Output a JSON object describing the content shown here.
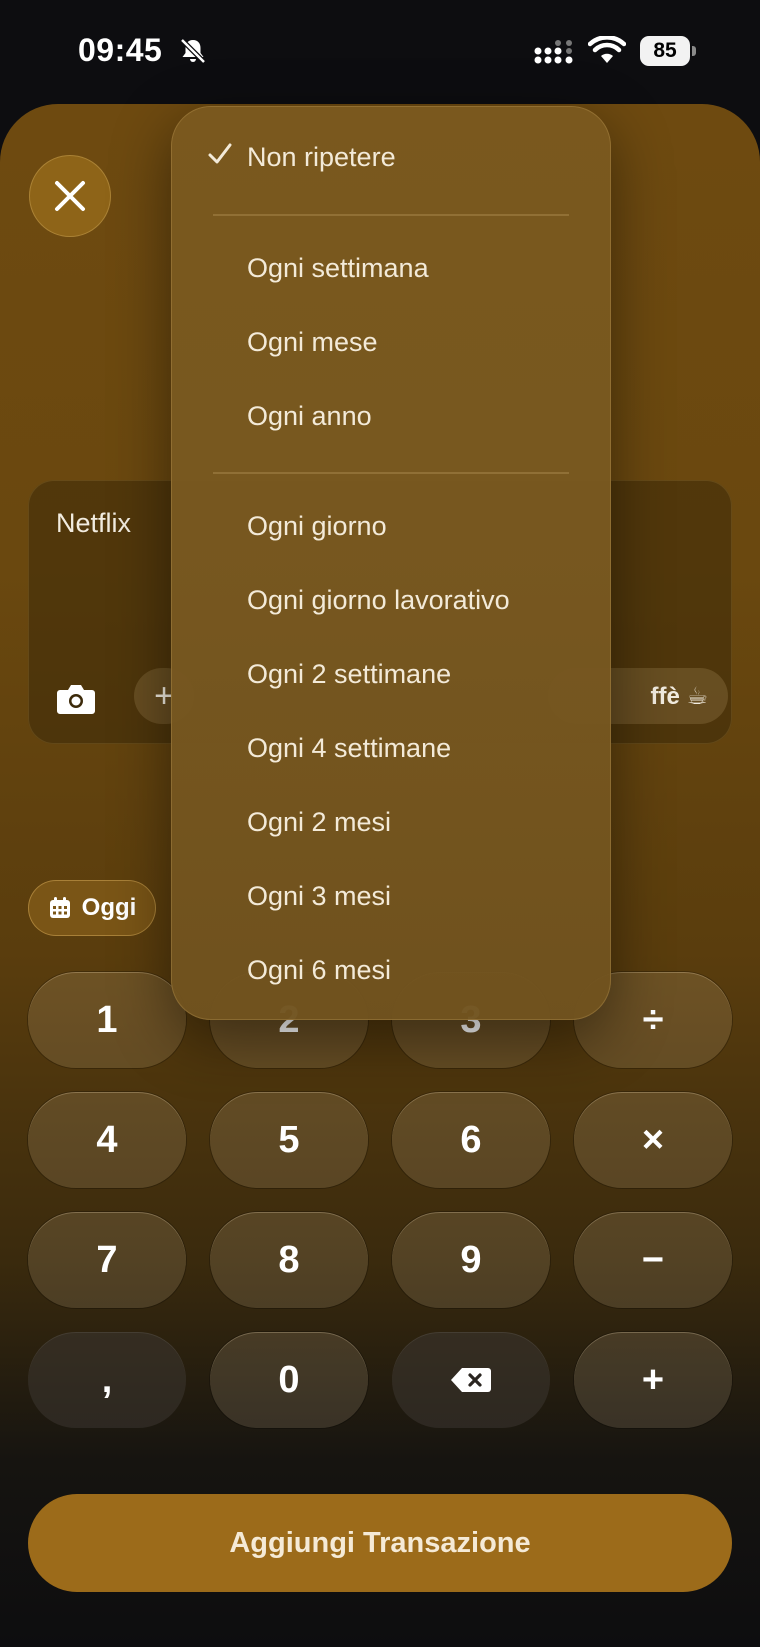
{
  "status_bar": {
    "time": "09:45",
    "battery": "85"
  },
  "card": {
    "name": "Netflix",
    "chip_coffee": "ffè ☕",
    "chip_add": "+"
  },
  "date_chip": {
    "label": "Oggi"
  },
  "keypad": {
    "k1": "1",
    "k2": "2",
    "k3": "3",
    "k_div": "÷",
    "k4": "4",
    "k5": "5",
    "k6": "6",
    "k_mul": "×",
    "k7": "7",
    "k8": "8",
    "k9": "9",
    "k_sub": "−",
    "k_comma": ",",
    "k0": "0",
    "k_add": "+"
  },
  "submit": {
    "label": "Aggiungi Transazione"
  },
  "repeat_menu": {
    "selected": "Non ripetere",
    "items": [
      "Non ripetere",
      "Ogni settimana",
      "Ogni mese",
      "Ogni anno",
      "Ogni giorno",
      "Ogni giorno lavorativo",
      "Ogni 2 settimane",
      "Ogni 4 settimane",
      "Ogni 2 mesi",
      "Ogni 3 mesi",
      "Ogni 6 mesi"
    ]
  },
  "colors": {
    "accent": "#9c6b1a",
    "sheet": "#6e4a10",
    "menu": "#7a581e"
  }
}
